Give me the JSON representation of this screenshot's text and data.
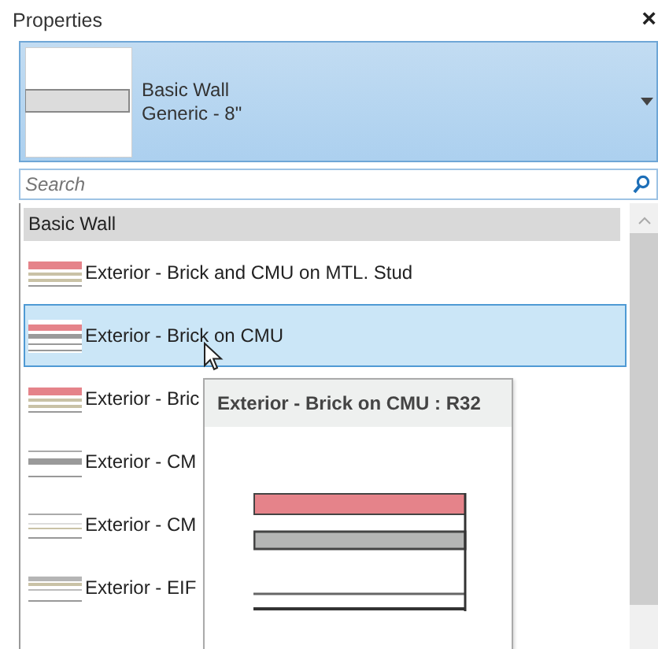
{
  "panel": {
    "title": "Properties",
    "close": "×"
  },
  "type_selector": {
    "family": "Basic Wall",
    "type": "Generic - 8\""
  },
  "search": {
    "placeholder": "Search"
  },
  "list": {
    "header": "Basic Wall",
    "items": [
      {
        "label": "Exterior - Brick and CMU on MTL. Stud",
        "kind": "brick",
        "selected": false
      },
      {
        "label": "Exterior - Brick on CMU",
        "kind": "brick-block",
        "selected": true
      },
      {
        "label": "Exterior - Bric",
        "kind": "brick",
        "selected": false
      },
      {
        "label": "Exterior - CM",
        "kind": "block",
        "selected": false
      },
      {
        "label": "Exterior - CM",
        "kind": "lined",
        "selected": false
      },
      {
        "label": "Exterior - EIF",
        "kind": "eifs",
        "selected": false
      }
    ]
  },
  "tooltip": {
    "title": "Exterior - Brick on CMU : R32"
  }
}
